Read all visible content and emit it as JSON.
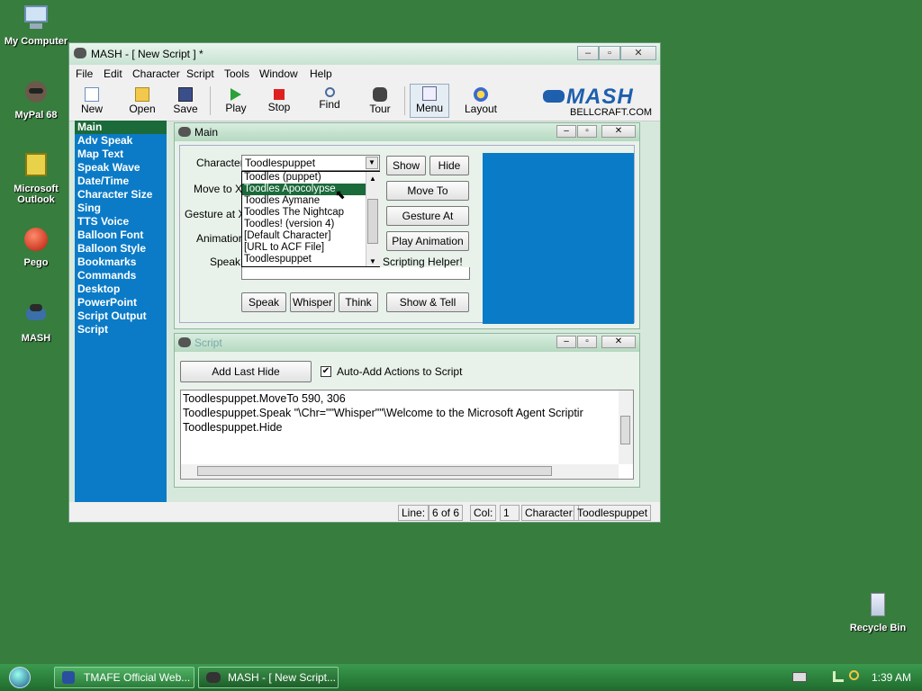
{
  "desktop": {
    "icons": [
      {
        "label": "My Computer",
        "icon": "computer-icon"
      },
      {
        "label": "MyPal 68",
        "icon": "raccoon-icon"
      },
      {
        "label": "Microsoft Outlook",
        "icon": "outlook-icon"
      },
      {
        "label": "Pego",
        "icon": "red-ball-icon"
      },
      {
        "label": "MASH",
        "icon": "mash-icon"
      },
      {
        "label": "Recycle Bin",
        "icon": "recycle-bin-icon"
      }
    ]
  },
  "window": {
    "title": "MASH - [ New Script ] *",
    "menu": [
      "File",
      "Edit",
      "Character",
      "Script",
      "Tools",
      "Window",
      "Help"
    ],
    "toolbar": [
      {
        "label": "New",
        "icon": "new-document-icon"
      },
      {
        "label": "Open",
        "icon": "folder-open-icon"
      },
      {
        "label": "Save",
        "icon": "floppy-disk-icon"
      },
      {
        "label": "Play",
        "icon": "play-icon"
      },
      {
        "label": "Stop",
        "icon": "stop-icon"
      },
      {
        "label": "Find",
        "icon": "magnifier-icon"
      },
      {
        "label": "Tour",
        "icon": "mash-icon"
      },
      {
        "label": "Menu",
        "icon": "menu-icon"
      },
      {
        "label": "Layout",
        "icon": "layout-icon"
      }
    ],
    "logo": {
      "text": "MASH",
      "sub": "BELLCRAFT.COM"
    },
    "sidebar": [
      "Main",
      "Adv Speak",
      "Map Text",
      "Speak Wave",
      "Date/Time",
      "Character Size",
      "Sing",
      "TTS Voice",
      "Balloon Font",
      "Balloon Style",
      "Bookmarks",
      "Commands",
      "Desktop",
      "PowerPoint",
      "Script Output",
      "Script"
    ],
    "main_panel": {
      "title": "Main",
      "labels": {
        "character": "Character",
        "move_to": "Move to X",
        "gesture_at": "Gesture at X",
        "animation": "Animation",
        "speak": "Speak"
      },
      "character_value": "Toodlespuppet",
      "dropdown_options": [
        "Toodles (puppet)",
        "Toodles Apocolypse",
        "Toodles Aymane",
        "Toodles The Nightcap",
        "Toodles! (version 4)",
        "[Default Character]",
        "[URL to ACF File]",
        "Toodlespuppet"
      ],
      "highlighted_option": "Toodles Apocolypse",
      "speak_text_visible": "Scripting Helper!",
      "buttons": {
        "show": "Show",
        "hide": "Hide",
        "move_to": "Move To",
        "gesture_at": "Gesture At",
        "play_animation": "Play Animation",
        "speak": "Speak",
        "whisper": "Whisper",
        "think": "Think",
        "show_tell": "Show & Tell"
      },
      "preview_color": "#0a7bc6"
    },
    "script_panel": {
      "title": "Script",
      "add_last_hide": "Add Last Hide",
      "auto_add_label": "Auto-Add Actions to Script",
      "auto_add_checked": true,
      "lines": [
        "Toodlespuppet.MoveTo 590, 306",
        "Toodlespuppet.Speak \"\\Chr=\"\"Whisper\"\"\\Welcome to the Microsoft Agent Scriptir",
        "Toodlespuppet.Hide"
      ]
    },
    "status": {
      "line_label": "Line:",
      "line_value": "6 of 6",
      "col_label": "Col:",
      "col_value": "1",
      "character_label": "Character:",
      "character_value": "Toodlespuppet"
    }
  },
  "taskbar": {
    "tasks": [
      "TMAFE Official Web...",
      "MASH - [ New Script..."
    ],
    "clock": "1:39 AM"
  }
}
